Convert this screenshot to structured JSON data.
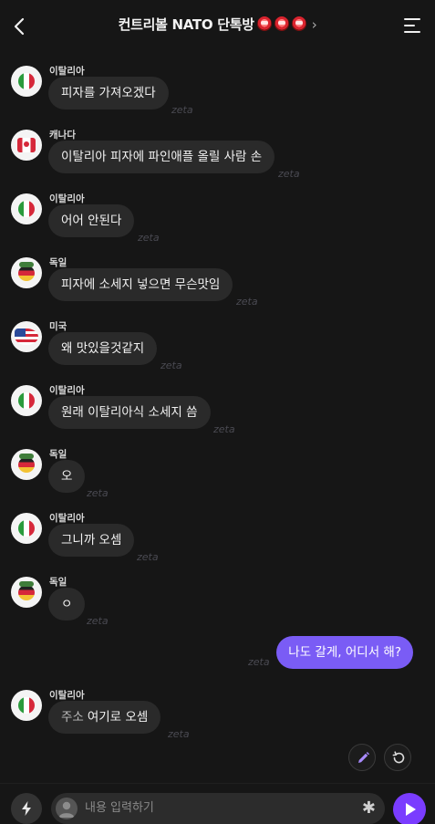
{
  "header": {
    "title": "컨트리볼 NATO 단톡방",
    "chevron": "›"
  },
  "messages": [
    {
      "sender": "이탈리아",
      "text": "피자를 가져오겠다",
      "zeta": "zeta",
      "avatar": "italy"
    },
    {
      "sender": "캐나다",
      "text": "이탈리아 피자에 파인애플 올릴 사람 손",
      "zeta": "zeta",
      "avatar": "canada"
    },
    {
      "sender": "이탈리아",
      "text": "어어 안된다",
      "zeta": "zeta",
      "avatar": "italy"
    },
    {
      "sender": "독일",
      "text": "피자에 소세지 넣으면 무슨맛임",
      "zeta": "zeta",
      "avatar": "germany"
    },
    {
      "sender": "미국",
      "text": "왜 맛있을것같지",
      "zeta": "zeta",
      "avatar": "usa"
    },
    {
      "sender": "이탈리아",
      "text": "원래 이탈리아식 소세지 씀",
      "zeta": "zeta",
      "avatar": "italy"
    },
    {
      "sender": "독일",
      "text": "오",
      "zeta": "zeta",
      "avatar": "germany"
    },
    {
      "sender": "이탈리아",
      "text": "그니까 오셈",
      "zeta": "zeta",
      "avatar": "italy"
    },
    {
      "sender": "독일",
      "text": "ㅇ",
      "zeta": "zeta",
      "avatar": "germany"
    }
  ],
  "my_message": {
    "text": "나도 갈게, 어디서 해?",
    "zeta": "zeta"
  },
  "last_message": {
    "sender": "이탈리아",
    "label": "주소",
    "text": "여기로 오셈",
    "zeta": "zeta"
  },
  "input": {
    "placeholder": "내용 입력하기",
    "asterisk": "✱"
  },
  "colors": {
    "accent": "#7a5cf5",
    "send": "#7a3cff",
    "background": "#161616",
    "bubble": "#2a2a2a"
  },
  "icons": [
    "back-icon",
    "menu-icon",
    "edit-icon",
    "refresh-icon",
    "bolt-icon",
    "send-icon"
  ]
}
